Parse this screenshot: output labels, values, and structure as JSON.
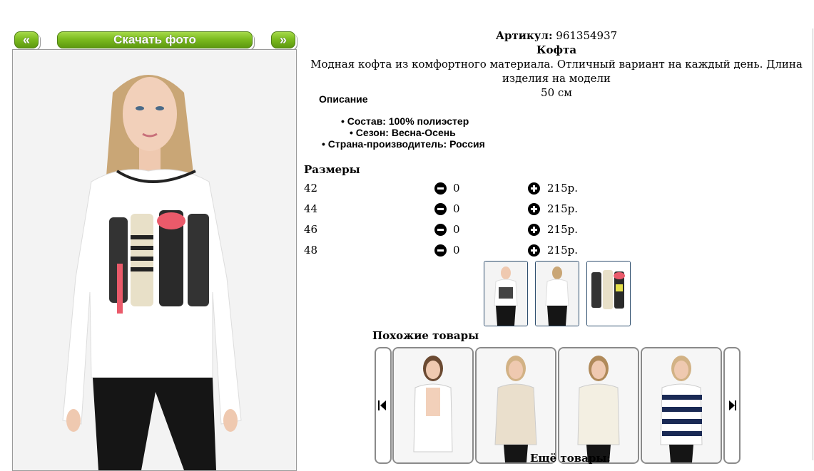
{
  "gallery": {
    "prev_label": "«",
    "download_label": "Скачать фото",
    "next_label": "»"
  },
  "product": {
    "article_label": "Артикул:",
    "article_value": "961354937",
    "name": "Кофта",
    "description_line1": "Модная кофта из комфортного материала. Отличный вариант на каждый день. Длина изделия на модели",
    "description_line2": "50 см"
  },
  "description": {
    "title": "Описание",
    "features": [
      "Состав: 100% полиэстер",
      "Сезон: Весна-Осень",
      "Страна-производитель: Россия"
    ]
  },
  "sizes": {
    "title": "Размеры",
    "rows": [
      {
        "size": "42",
        "qty": "0",
        "price": "215р."
      },
      {
        "size": "44",
        "qty": "0",
        "price": "215р."
      },
      {
        "size": "46",
        "qty": "0",
        "price": "215р."
      },
      {
        "size": "48",
        "qty": "0",
        "price": "215р."
      }
    ]
  },
  "similar": {
    "title": "Похожие товары"
  },
  "more": {
    "title": "Ещё товары:"
  },
  "colors": {
    "button_green": "#7cbc1f",
    "thumb_border": "#2f4f6f",
    "card_border": "#8a8a8a"
  },
  "icons": {
    "minus": "minus-circle-icon",
    "plus": "plus-circle-icon",
    "prev": "skip-previous-icon",
    "next": "skip-next-icon"
  }
}
